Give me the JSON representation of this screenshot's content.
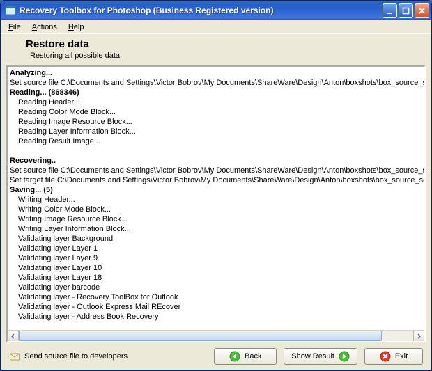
{
  "window": {
    "title": "Recovery Toolbox for Photoshop (Business Registered version)"
  },
  "menubar": {
    "file": "File",
    "actions": "Actions",
    "help": "Help"
  },
  "page": {
    "title": "Restore data",
    "subtitle": "Restoring all possible data."
  },
  "log": {
    "analyzing_header": "Analyzing...",
    "analyzing_set_source": "Set source file C:\\Documents and Settings\\Victor Bobrov\\My Documents\\ShareWare\\Design\\Anton\\boxshots\\box_source_set",
    "reading_header": "Reading... (868346)",
    "reading_lines": [
      "Reading Header...",
      "Reading Color Mode Block...",
      "Reading Image Resource Block...",
      "Reading Layer Information Block...",
      "Reading Result Image..."
    ],
    "recovering_header": "Recovering..",
    "recovering_set_source": "Set source file C:\\Documents and Settings\\Victor Bobrov\\My Documents\\ShareWare\\Design\\Anton\\boxshots\\box_source_set",
    "recovering_set_target": "Set target file C:\\Documents and Settings\\Victor Bobrov\\My Documents\\ShareWare\\Design\\Anton\\boxshots\\box_source_set",
    "saving_header": "Saving... (5)",
    "saving_lines": [
      "Writing Header...",
      "Writing Color Mode Block...",
      "Writing Image Resource Block...",
      "Writing Layer Information Block...",
      "Validating layer Background",
      "Validating layer Layer 1",
      "Validating layer Layer 9",
      "Validating layer Layer 10",
      "Validating layer Layer 18",
      "Validating layer barcode",
      "Validating layer - Recovery ToolBox for Outlook",
      "Validating layer - Outlook Express Mail REcover",
      "Validating layer - Address Book Recovery"
    ]
  },
  "footer": {
    "send_link": "Send source file to developers",
    "back": "Back",
    "show_result": "Show Result",
    "exit": "Exit"
  }
}
